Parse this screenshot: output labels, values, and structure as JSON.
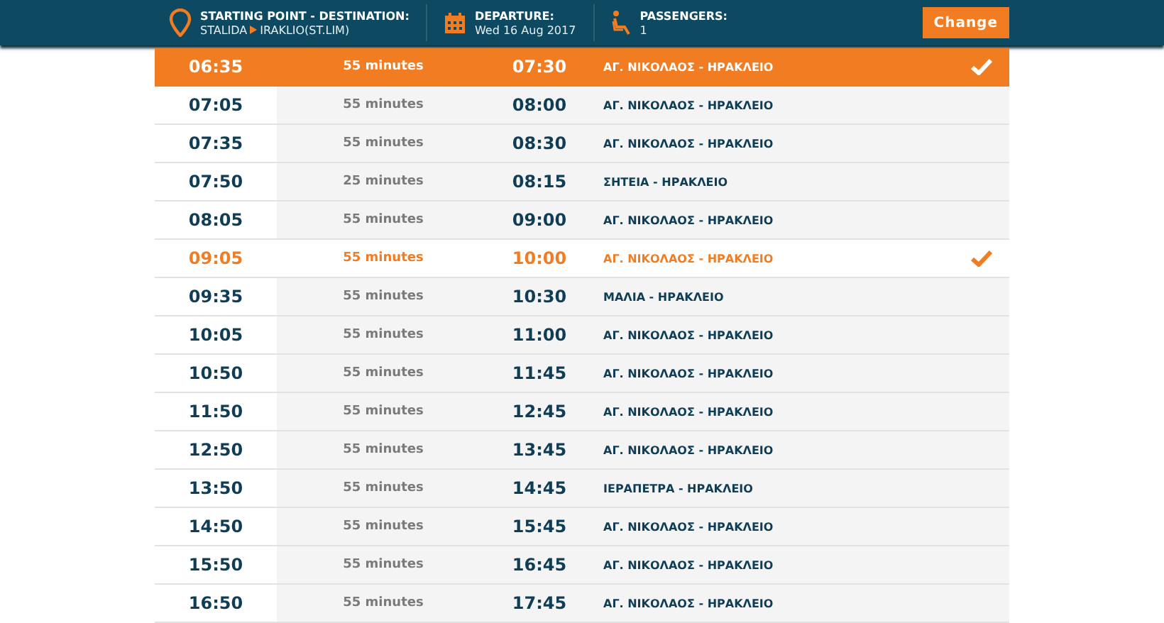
{
  "header": {
    "route_label": "STARTING POINT - DESTINATION:",
    "origin": "STALIDA",
    "destination": "IRAKLIO(ST.LIM)",
    "departure_label": "DEPARTURE:",
    "departure_date": "Wed 16 Aug 2017",
    "passengers_label": "PASSENGERS:",
    "passengers": "1",
    "change_button": "Change"
  },
  "trips": [
    {
      "depart": "06:35",
      "duration": "55 minutes",
      "arrive": "07:30",
      "route": "ΑΓ. ΝΙΚΟΛΑΟΣ - ΗΡΑΚΛΕΙΟ",
      "selected": true,
      "marked": false
    },
    {
      "depart": "07:05",
      "duration": "55 minutes",
      "arrive": "08:00",
      "route": "ΑΓ. ΝΙΚΟΛΑΟΣ - ΗΡΑΚΛΕΙΟ",
      "selected": false,
      "marked": false
    },
    {
      "depart": "07:35",
      "duration": "55 minutes",
      "arrive": "08:30",
      "route": "ΑΓ. ΝΙΚΟΛΑΟΣ - ΗΡΑΚΛΕΙΟ",
      "selected": false,
      "marked": false
    },
    {
      "depart": "07:50",
      "duration": "25 minutes",
      "arrive": "08:15",
      "route": "ΣΗΤΕΙΑ - ΗΡΑΚΛΕΙΟ",
      "selected": false,
      "marked": false
    },
    {
      "depart": "08:05",
      "duration": "55 minutes",
      "arrive": "09:00",
      "route": "ΑΓ. ΝΙΚΟΛΑΟΣ - ΗΡΑΚΛΕΙΟ",
      "selected": false,
      "marked": false
    },
    {
      "depart": "09:05",
      "duration": "55 minutes",
      "arrive": "10:00",
      "route": "ΑΓ. ΝΙΚΟΛΑΟΣ - ΗΡΑΚΛΕΙΟ",
      "selected": false,
      "marked": true
    },
    {
      "depart": "09:35",
      "duration": "55 minutes",
      "arrive": "10:30",
      "route": "ΜΑΛΙΑ - ΗΡΑΚΛΕΙΟ",
      "selected": false,
      "marked": false
    },
    {
      "depart": "10:05",
      "duration": "55 minutes",
      "arrive": "11:00",
      "route": "ΑΓ. ΝΙΚΟΛΑΟΣ - ΗΡΑΚΛΕΙΟ",
      "selected": false,
      "marked": false
    },
    {
      "depart": "10:50",
      "duration": "55 minutes",
      "arrive": "11:45",
      "route": "ΑΓ. ΝΙΚΟΛΑΟΣ - ΗΡΑΚΛΕΙΟ",
      "selected": false,
      "marked": false
    },
    {
      "depart": "11:50",
      "duration": "55 minutes",
      "arrive": "12:45",
      "route": "ΑΓ. ΝΙΚΟΛΑΟΣ - ΗΡΑΚΛΕΙΟ",
      "selected": false,
      "marked": false
    },
    {
      "depart": "12:50",
      "duration": "55 minutes",
      "arrive": "13:45",
      "route": "ΑΓ. ΝΙΚΟΛΑΟΣ - ΗΡΑΚΛΕΙΟ",
      "selected": false,
      "marked": false
    },
    {
      "depart": "13:50",
      "duration": "55 minutes",
      "arrive": "14:45",
      "route": "ΙΕΡΑΠΕΤΡΑ - ΗΡΑΚΛΕΙΟ",
      "selected": false,
      "marked": false
    },
    {
      "depart": "14:50",
      "duration": "55 minutes",
      "arrive": "15:45",
      "route": "ΑΓ. ΝΙΚΟΛΑΟΣ - ΗΡΑΚΛΕΙΟ",
      "selected": false,
      "marked": false
    },
    {
      "depart": "15:50",
      "duration": "55 minutes",
      "arrive": "16:45",
      "route": "ΑΓ. ΝΙΚΟΛΑΟΣ - ΗΡΑΚΛΕΙΟ",
      "selected": false,
      "marked": false
    },
    {
      "depart": "16:50",
      "duration": "55 minutes",
      "arrive": "17:45",
      "route": "ΑΓ. ΝΙΚΟΛΑΟΣ - ΗΡΑΚΛΕΙΟ",
      "selected": false,
      "marked": false
    }
  ]
}
